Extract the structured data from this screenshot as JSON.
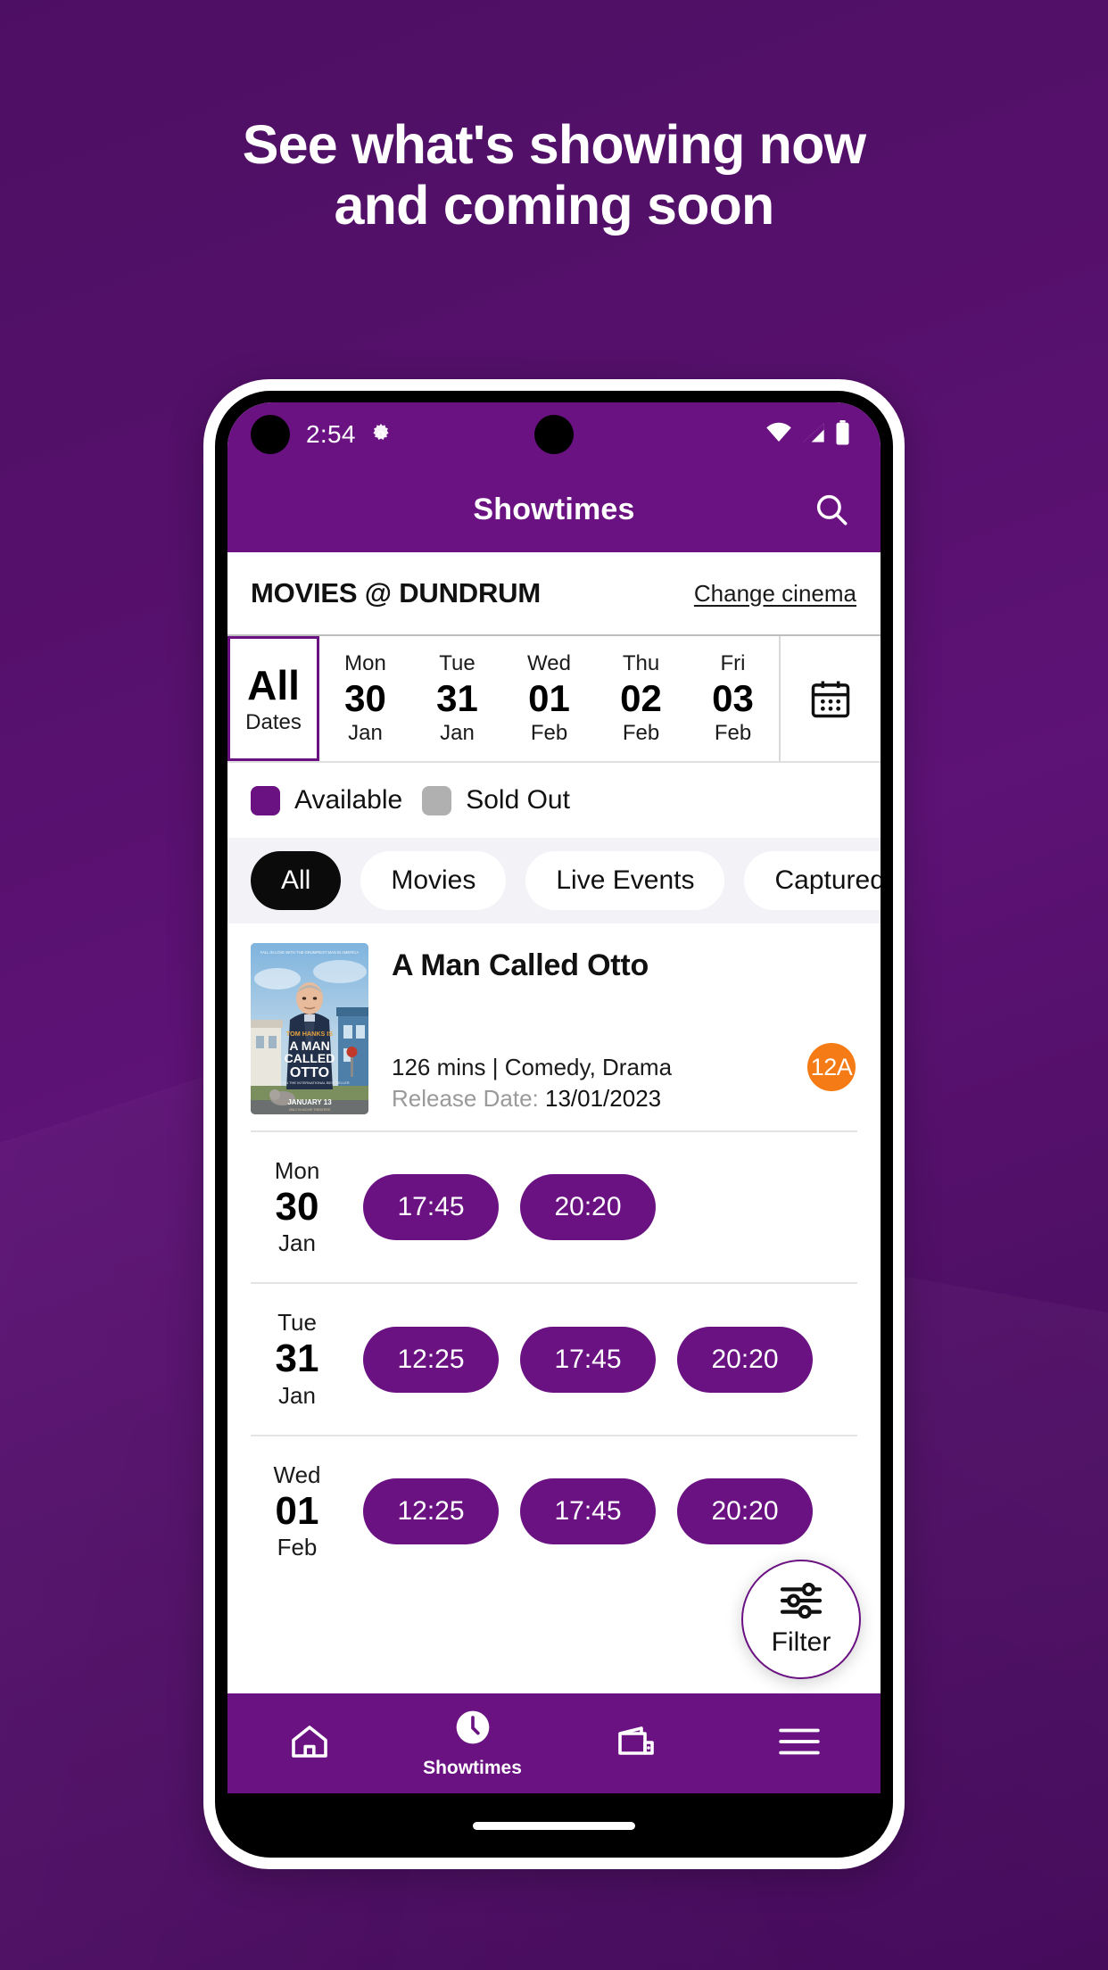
{
  "promo": {
    "headline_line1": "See what's showing now",
    "headline_line2": "and coming soon"
  },
  "status_bar": {
    "time": "2:54",
    "gear_icon": "gear-icon",
    "wifi_icon": "wifi-icon",
    "signal_icon": "cellular-signal-icon",
    "battery_icon": "battery-icon"
  },
  "app_bar": {
    "title": "Showtimes",
    "search_icon": "search-icon"
  },
  "cinema": {
    "name": "MOVIES @ DUNDRUM",
    "change_link": "Change cinema"
  },
  "date_strip": {
    "calendar_icon": "calendar-icon",
    "dates": [
      {
        "dow": "",
        "num": "All",
        "mon": "Dates",
        "selected": true
      },
      {
        "dow": "Mon",
        "num": "30",
        "mon": "Jan",
        "selected": false
      },
      {
        "dow": "Tue",
        "num": "31",
        "mon": "Jan",
        "selected": false
      },
      {
        "dow": "Wed",
        "num": "01",
        "mon": "Feb",
        "selected": false
      },
      {
        "dow": "Thu",
        "num": "02",
        "mon": "Feb",
        "selected": false
      },
      {
        "dow": "Fri",
        "num": "03",
        "mon": "Feb",
        "selected": false
      }
    ]
  },
  "legend": [
    {
      "label": "Available",
      "color": "#6b1283"
    },
    {
      "label": "Sold Out",
      "color": "#b0b0b0"
    }
  ],
  "category_chips": [
    {
      "label": "All",
      "active": true
    },
    {
      "label": "Movies",
      "active": false
    },
    {
      "label": "Live Events",
      "active": false
    },
    {
      "label": "Captured",
      "active": false
    }
  ],
  "movie": {
    "title": "A Man Called Otto",
    "runtime_genre": "126 mins | Comedy, Drama",
    "release_label": "Release Date: ",
    "release_value": "13/01/2023",
    "rating": "12A",
    "rating_color": "#f47b16",
    "poster": {
      "tagline": "FALL IN LOVE WITH THE GRUMPIEST MAN IN AMERICA",
      "star_line": "TOM HANKS IS",
      "title_line1": "A MAN",
      "title_line2": "CALLED",
      "title_line3": "OTTO",
      "credits": "BASED ON THE INTERNATIONAL BESTSELLER",
      "date_line": "JANUARY 13",
      "sub_date_line": "ONLY IN MOVIE THEATERS"
    }
  },
  "showtimes": [
    {
      "dow": "Mon",
      "num": "30",
      "mon": "Jan",
      "times": [
        "17:45",
        "20:20"
      ]
    },
    {
      "dow": "Tue",
      "num": "31",
      "mon": "Jan",
      "times": [
        "12:25",
        "17:45",
        "20:20"
      ]
    },
    {
      "dow": "Wed",
      "num": "01",
      "mon": "Feb",
      "times": [
        "12:25",
        "17:45",
        "20:20"
      ]
    }
  ],
  "filter_fab": {
    "label": "Filter",
    "icon": "sliders-icon"
  },
  "bottom_nav": [
    {
      "label": "",
      "icon": "home-icon",
      "active": false
    },
    {
      "label": "Showtimes",
      "icon": "clock-icon",
      "active": true
    },
    {
      "label": "",
      "icon": "wallet-icon",
      "active": false
    },
    {
      "label": "",
      "icon": "hamburger-menu-icon",
      "active": false
    }
  ],
  "theme": {
    "brand_purple": "#6b1283",
    "page_background": "#511069",
    "chip_active": "#0b0b0b",
    "sold_out_grey": "#b0b0b0"
  }
}
